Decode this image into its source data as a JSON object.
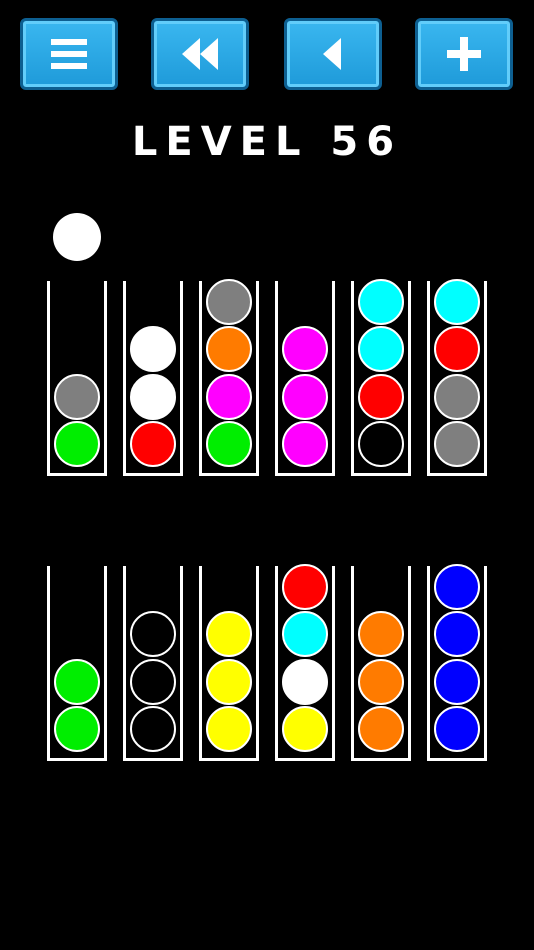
{
  "toolbar": {
    "buttons": [
      {
        "id": "menu",
        "icon": "menu-icon"
      },
      {
        "id": "rewind",
        "icon": "rewind-icon"
      },
      {
        "id": "back",
        "icon": "back-icon"
      },
      {
        "id": "add",
        "icon": "plus-icon"
      }
    ]
  },
  "level": {
    "title": "LEVEL 56"
  },
  "held_ball": {
    "color": "#ffffff"
  },
  "palette": {
    "green": "#00ee00",
    "gray": "#7f7f7f",
    "white": "#ffffff",
    "red": "#ff0000",
    "orange": "#ff7b00",
    "magenta": "#ff00ff",
    "cyan": "#00ffff",
    "black": "#000000",
    "yellow": "#ffff00",
    "blue": "#0000ff"
  },
  "tubes": [
    {
      "balls": [
        "green",
        "gray"
      ]
    },
    {
      "balls": [
        "red",
        "white",
        "white"
      ]
    },
    {
      "balls": [
        "green",
        "magenta",
        "orange",
        "gray"
      ]
    },
    {
      "balls": [
        "magenta",
        "magenta",
        "magenta"
      ]
    },
    {
      "balls": [
        "black",
        "red",
        "cyan",
        "cyan"
      ]
    },
    {
      "balls": [
        "gray",
        "gray",
        "red",
        "cyan"
      ]
    },
    {
      "balls": [
        "green",
        "green"
      ]
    },
    {
      "balls": [
        "black",
        "black",
        "black"
      ]
    },
    {
      "balls": [
        "yellow",
        "yellow",
        "yellow"
      ]
    },
    {
      "balls": [
        "yellow",
        "white",
        "cyan",
        "red"
      ]
    },
    {
      "balls": [
        "orange",
        "orange",
        "orange"
      ]
    },
    {
      "balls": [
        "blue",
        "blue",
        "blue",
        "blue"
      ]
    }
  ]
}
